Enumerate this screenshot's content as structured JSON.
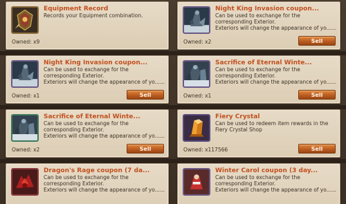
{
  "items": [
    {
      "name": "Equipment Record",
      "description": "Records your Equipment combination.",
      "owned": "Owned: x9",
      "sell_label": "",
      "icon": "equipment-record-icon"
    },
    {
      "name": "Night King Invasion coupon...",
      "description": "Can be used to exchange for the\ncorresponding Exterior.\nExteriors will change the appearance of yo......",
      "owned": "Owned: x2",
      "sell_label": "Sell",
      "icon": "night-king-invasion-coupon-icon"
    },
    {
      "name": "Night King Invasion coupon...",
      "description": "Can be used to exchange for the\ncorresponding Exterior.\nExteriors will change the appearance of yo......",
      "owned": "Owned: x1",
      "sell_label": "Sell",
      "icon": "night-king-invasion-coupon-icon"
    },
    {
      "name": "Sacrifice of Eternal Winte...",
      "description": "Can be used to exchange for the\ncorresponding Exterior.\nExteriors will change the appearance of yo......",
      "owned": "Owned: x1",
      "sell_label": "Sell",
      "icon": "sacrifice-of-eternal-winter-icon"
    },
    {
      "name": "Sacrifice of Eternal Winte...",
      "description": "Can be used to exchange for the\ncorresponding Exterior.\nExteriors will change the appearance of yo......",
      "owned": "Owned: x2",
      "sell_label": "Sell",
      "icon": "sacrifice-of-eternal-winter-icon"
    },
    {
      "name": "Fiery Crystal",
      "description": "Can be used to redeem item rewards in the\nFiery Crystal Shop",
      "owned": "Owned: x117566",
      "sell_label": "Sell",
      "icon": "fiery-crystal-icon"
    },
    {
      "name": "Dragon's Rage coupon (7 da...",
      "description": "Can be used to exchange for the\ncorresponding Exterior.\nExteriors will change the appearance of yo......",
      "owned": "",
      "sell_label": "",
      "icon": "dragons-rage-coupon-icon"
    },
    {
      "name": "Winter Carol coupon (3 day...",
      "description": "Can be used to exchange for the\ncorresponding Exterior.\nExteriors will change the appearance of yo......",
      "owned": "",
      "sell_label": "",
      "icon": "winter-carol-coupon-icon"
    }
  ],
  "colors": {
    "title": "#c0501f",
    "sell_button": "#b85a1f",
    "card_bg": "#e0d2bb",
    "frame_border": "#6a5a86"
  }
}
